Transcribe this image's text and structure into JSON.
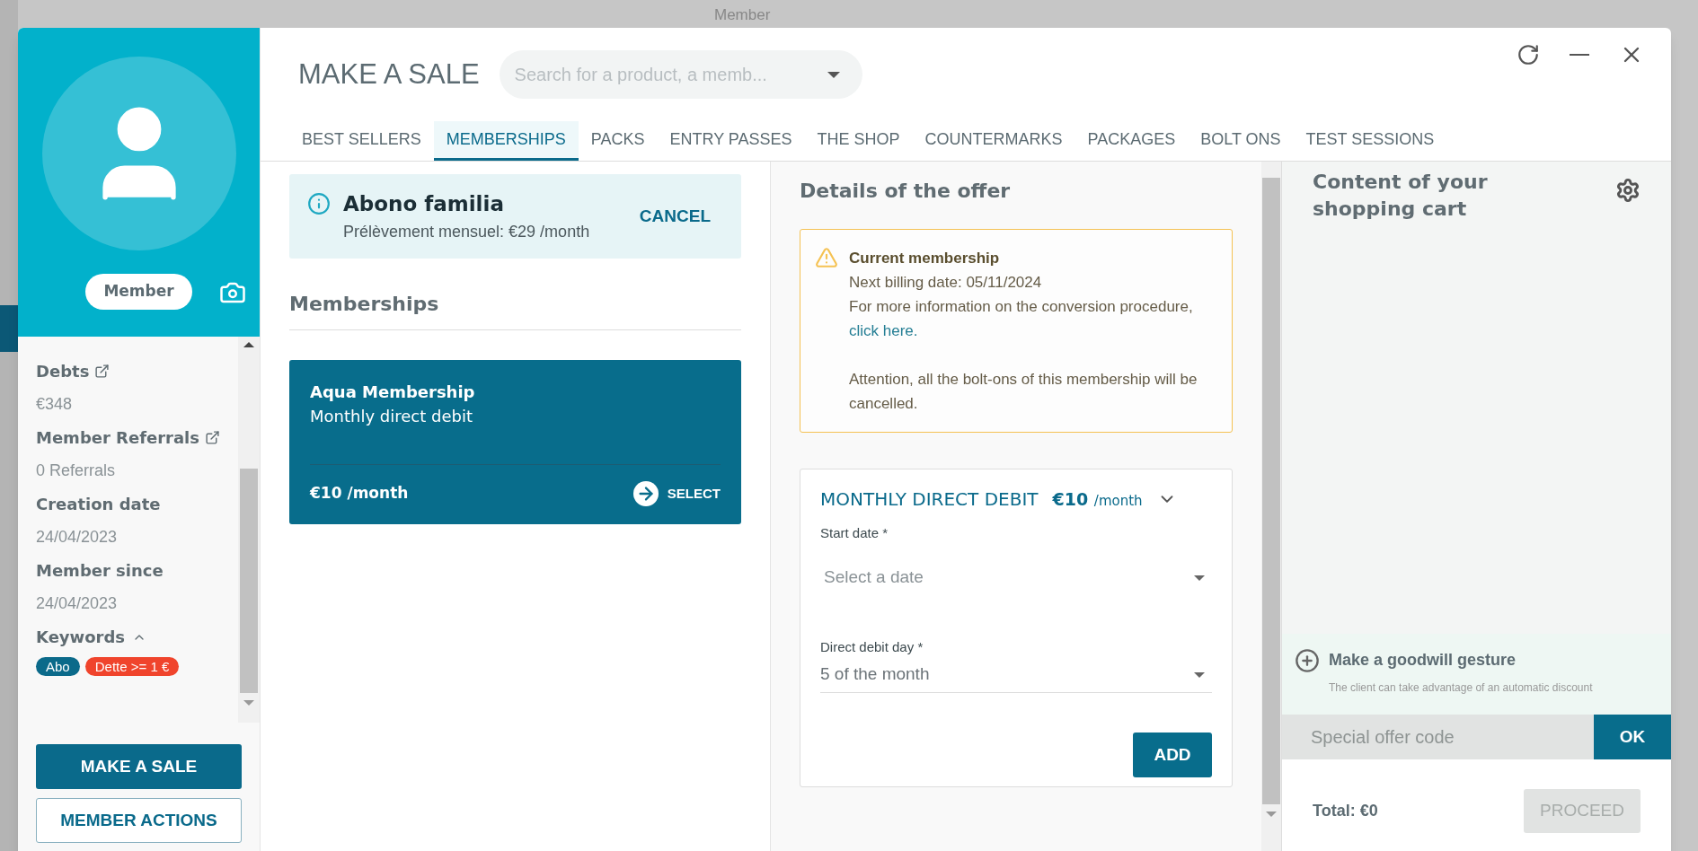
{
  "backdrop": {
    "label": "Member"
  },
  "member": {
    "badge": "Member",
    "fields": [
      {
        "label": "Debts",
        "link": true,
        "value": "€348"
      },
      {
        "label": "Member Referrals",
        "link": true,
        "value": "0 Referrals"
      },
      {
        "label": "Creation date",
        "link": false,
        "value": "24/04/2023"
      },
      {
        "label": "Member since",
        "link": false,
        "value": "24/04/2023"
      }
    ],
    "keywords_label": "Keywords",
    "keywords_expanded": true,
    "keywords": [
      {
        "label": "Abo",
        "color": "#0b6a8a"
      },
      {
        "label": "Dette >= 1 €",
        "color": "#f0442c"
      }
    ],
    "actions": [
      {
        "label": "MAKE A SALE",
        "kind": "primary"
      },
      {
        "label": "MEMBER ACTIONS",
        "kind": "outline"
      }
    ]
  },
  "header": {
    "title": "MAKE A SALE",
    "search_placeholder": "Search for a product, a memb..."
  },
  "tabs": [
    {
      "label": "BEST SELLERS",
      "selected": false
    },
    {
      "label": "MEMBERSHIPS",
      "selected": true
    },
    {
      "label": "PACKS",
      "selected": false
    },
    {
      "label": "ENTRY PASSES",
      "selected": false
    },
    {
      "label": "THE SHOP",
      "selected": false
    },
    {
      "label": "COUNTERMARKS",
      "selected": false
    },
    {
      "label": "PACKAGES",
      "selected": false
    },
    {
      "label": "BOLT ONS",
      "selected": false
    },
    {
      "label": "TEST SESSIONS",
      "selected": false
    }
  ],
  "current_offer": {
    "name": "Abono familia",
    "detail": "Prélèvement mensuel: €29 /month",
    "action": "CANCEL"
  },
  "memberships": {
    "heading": "Memberships",
    "items": [
      {
        "name": "Aqua Membership",
        "plan": "Monthly direct debit",
        "price": "€10",
        "unit": "/month",
        "action": "SELECT"
      }
    ]
  },
  "details": {
    "heading": "Details of the offer",
    "notice": {
      "title": "Current membership",
      "billing": "Next billing date: 05/11/2024",
      "info": "For more information on the conversion procedure,",
      "link": "click here.",
      "warning": "Attention, all the bolt-ons of this membership will be cancelled."
    },
    "plan": {
      "title": "MONTHLY DIRECT DEBIT",
      "price": "€10",
      "unit": "/month",
      "expanded": true,
      "fields": [
        {
          "label": "Start date *",
          "placeholder": "Select a date"
        },
        {
          "label": "Direct debit day *",
          "value": "5 of the month"
        }
      ],
      "action": "ADD"
    }
  },
  "cart": {
    "heading": "Content of your shopping cart",
    "goodwill": {
      "title": "Make a goodwill gesture",
      "hint": "The client can take advantage of an automatic discount"
    },
    "code_placeholder": "Special offer code",
    "code_action": "OK",
    "total": "Total: €0",
    "proceed": "PROCEED",
    "proceed_disabled": true
  }
}
